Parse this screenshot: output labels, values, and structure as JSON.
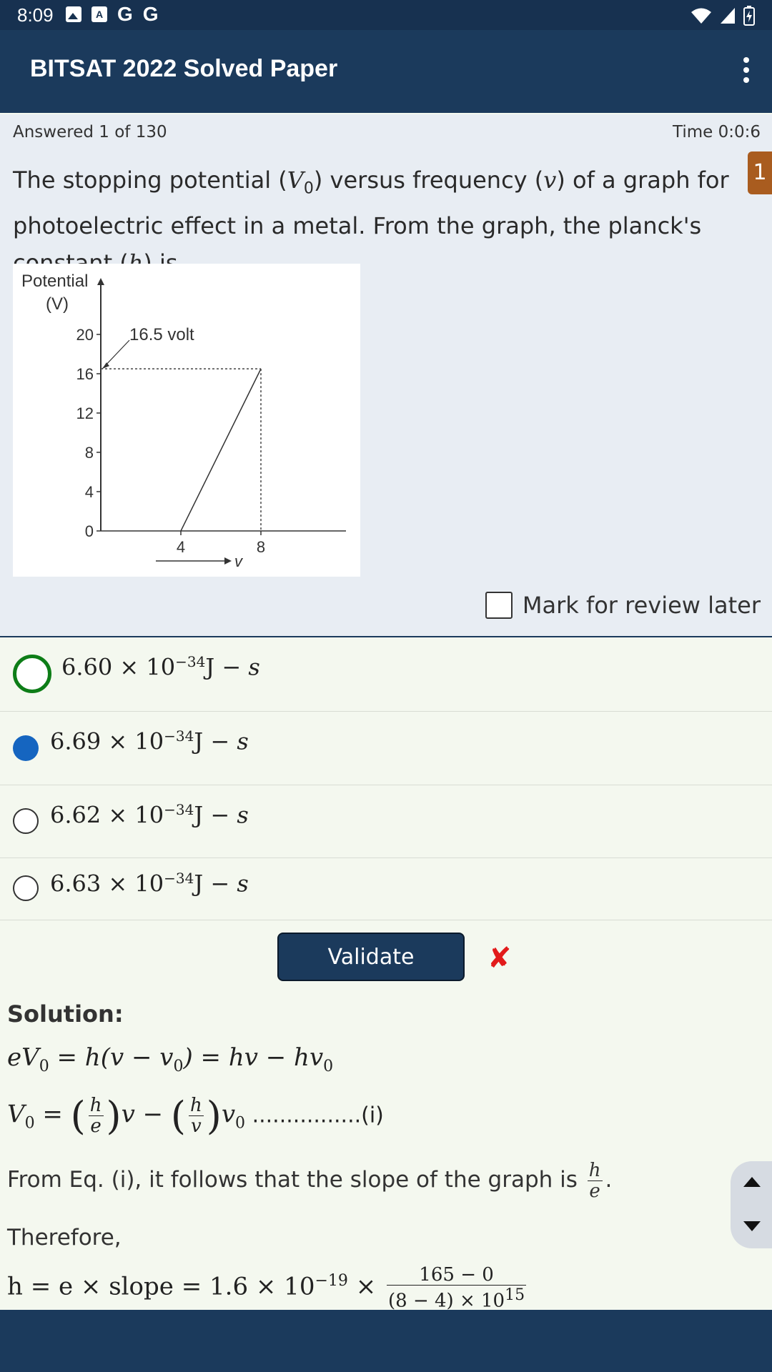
{
  "status_bar": {
    "time": "8:09",
    "notif_g1": "G",
    "notif_g2": "G"
  },
  "app_bar": {
    "title": "BITSAT 2022 Solved Paper"
  },
  "progress": {
    "answered": "Answered 1 of 130",
    "time": "Time 0:0:6"
  },
  "question": {
    "number": "1",
    "text_part1": "The stopping potential (",
    "symbol_V": "V",
    "sub_0": "0",
    "text_part2": ") versus frequency (",
    "symbol_v": "v",
    "text_part3": ") of a graph for photoelectric effect in a metal. From the graph, the planck's constant (",
    "symbol_h": "h",
    "text_part4": ") is.",
    "mark_review": "Mark for review later"
  },
  "chart_data": {
    "type": "line",
    "ylabel_line1": "Potential",
    "ylabel_line2": "(V)",
    "xlabel": "v",
    "yticks": [
      0,
      4,
      8,
      12,
      16,
      20
    ],
    "xticks": [
      4,
      8
    ],
    "ylim": [
      0,
      22
    ],
    "xlim": [
      0,
      10
    ],
    "annotation": "16.5 volt",
    "series": [
      {
        "x": [
          4,
          8
        ],
        "y": [
          0,
          16.5
        ]
      }
    ]
  },
  "options": [
    {
      "mantissa": "6.60 × 10",
      "exp": "−34",
      "unit": "J − ",
      "s": "s",
      "state": "correct"
    },
    {
      "mantissa": "6.69 × 10",
      "exp": "−34",
      "unit": "J − ",
      "s": "s",
      "state": "selected"
    },
    {
      "mantissa": "6.62 × 10",
      "exp": "−34",
      "unit": "J − ",
      "s": "s",
      "state": "none"
    },
    {
      "mantissa": "6.63 × 10",
      "exp": "−34",
      "unit": "J − ",
      "s": "s",
      "state": "none"
    }
  ],
  "validate": {
    "label": "Validate",
    "result_mark": "✘"
  },
  "solution": {
    "title": "Solution:",
    "eq1": {
      "e": "eV",
      "sub0": "0",
      "mid": " = h(v − v",
      "sub0b": "0",
      "end": ") = hv − hv",
      "sub0c": "0"
    },
    "eq2": {
      "lhs": "V",
      "sub0": "0",
      "eq": " = ",
      "h1": "h",
      "e": "e",
      "v": "v",
      "minus": " − ",
      "h2": "h",
      "v2": "v",
      "v0": "v",
      "sub0b": "0",
      "dots": " ................(i)"
    },
    "line3_text": "From Eq. (i), it follows that the slope of the graph is ",
    "line3_num": "h",
    "line3_den": "e",
    "line3_end": ".",
    "line4": "Therefore,",
    "eq5": {
      "lhs": "h = e × slope = 1.6 × 10",
      "exp": "−19",
      "times": " × ",
      "num": "165 − 0",
      "den": "(8 − 4) × 10",
      "den_exp": "15"
    }
  }
}
